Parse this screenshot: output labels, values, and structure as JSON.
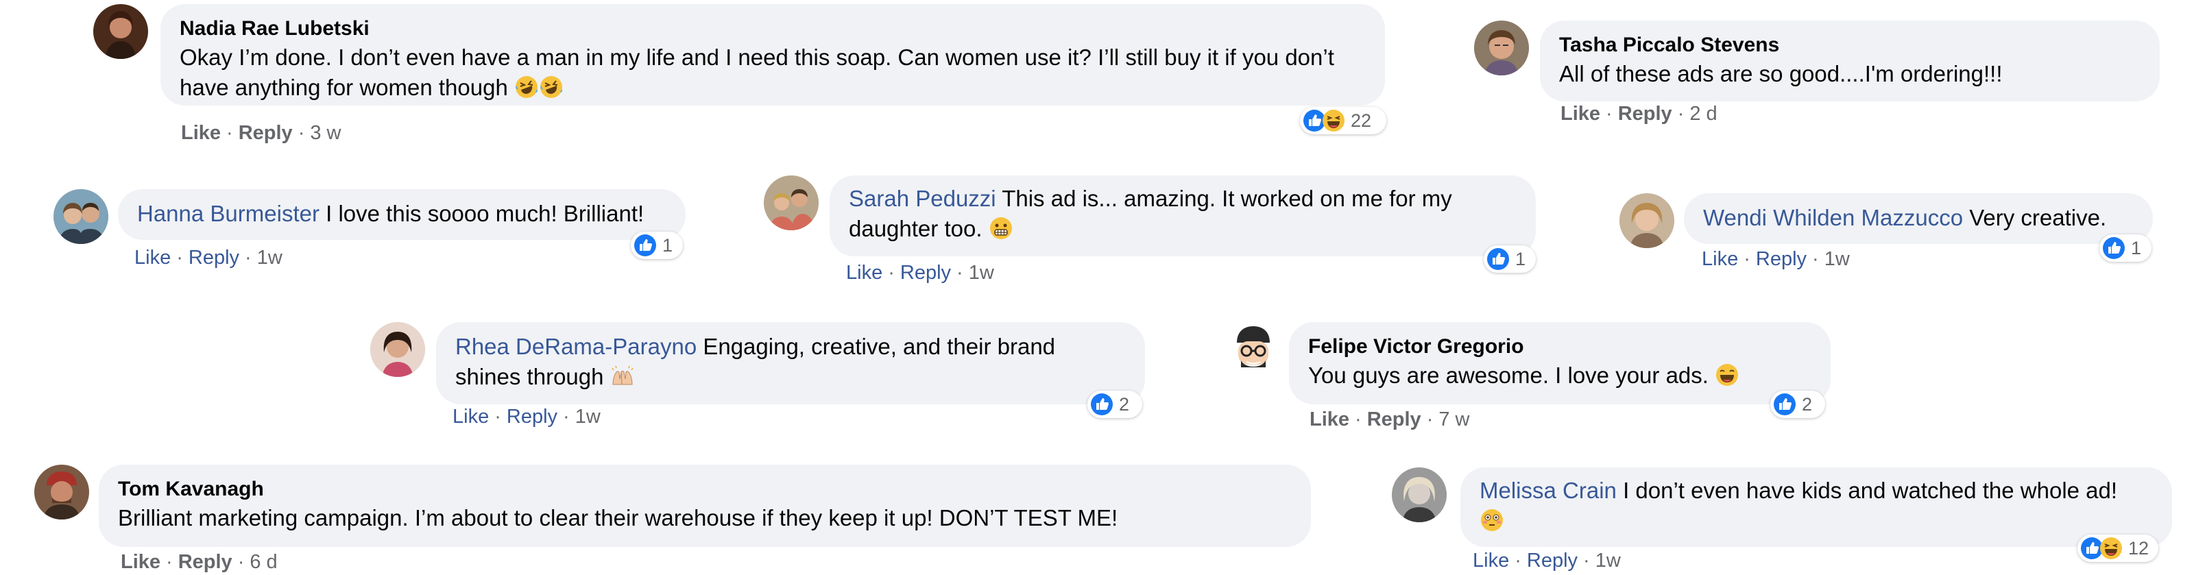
{
  "actions": {
    "like": "Like",
    "reply": "Reply",
    "separator": "·"
  },
  "comments": [
    {
      "author": "Nadia Rae Lubetski",
      "text": "Okay I’m done. I don’t even have a man in my life and I need this soap. Can women use it? I’ll still buy it if you don’t have anything for women though",
      "emoji": [
        "rofl-emoji",
        "rofl-emoji"
      ],
      "time": "3 w",
      "reactions": [
        "like-reaction",
        "haha-reaction"
      ],
      "reaction_count": "22"
    },
    {
      "author": "Tasha Piccalo Stevens",
      "text": "All of these ads are so good....I'm ordering!!!",
      "time": "2 d"
    },
    {
      "author": "Hanna Burmeister",
      "text": "I love this soooo much! Brilliant!",
      "time": "1w",
      "reactions": [
        "like-reaction"
      ],
      "reaction_count": "1"
    },
    {
      "author": "Sarah Peduzzi",
      "text_line1": "This ad is... amazing. It worked on me for my",
      "text_line2": "daughter too.",
      "emoji": [
        "grimace-emoji"
      ],
      "time": "1w",
      "reactions": [
        "like-reaction"
      ],
      "reaction_count": "1"
    },
    {
      "author": "Wendi Whilden Mazzucco",
      "text": "Very creative.",
      "time": "1w",
      "reactions": [
        "like-reaction"
      ],
      "reaction_count": "1"
    },
    {
      "author": "Rhea DeRama-Parayno",
      "text_line1": "Engaging, creative, and their brand",
      "text_line2": "shines through",
      "emoji": [
        "raised-hands-emoji"
      ],
      "time": "1w",
      "reactions": [
        "like-reaction"
      ],
      "reaction_count": "2"
    },
    {
      "author": "Felipe Victor Gregorio",
      "text": "You guys are awesome. I love your ads.",
      "emoji": [
        "laughing-emoji"
      ],
      "time": "7 w",
      "reactions": [
        "like-reaction"
      ],
      "reaction_count": "2"
    },
    {
      "author": "Tom Kavanagh",
      "text": "Brilliant marketing campaign. I’m about to clear their warehouse if they keep it up! DON’T TEST ME!",
      "time": "6 d"
    },
    {
      "author": "Melissa Crain",
      "text": "I don’t even have kids and watched the whole ad!",
      "emoji": [
        "flushed-emoji"
      ],
      "time": "1w",
      "reactions": [
        "like-reaction",
        "haha-reaction"
      ],
      "reaction_count": "12"
    }
  ],
  "colors": {
    "bubble": "#f0f2f5",
    "link": "#385898",
    "like_blue": "#1877f2",
    "meta": "#65676b"
  }
}
